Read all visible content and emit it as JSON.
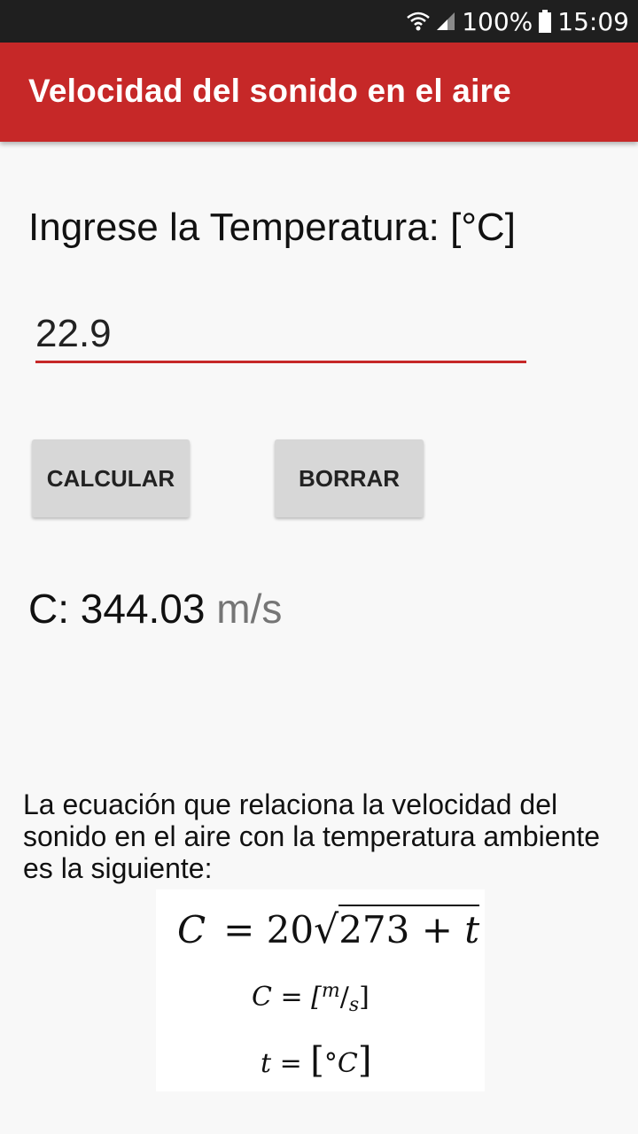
{
  "status_bar": {
    "battery": "100%",
    "time": "15:09",
    "icons": [
      "wifi-icon",
      "signal-icon",
      "battery-icon"
    ],
    "background": "#1f1f1f"
  },
  "app_bar": {
    "title": "Velocidad del sonido en el aire",
    "color": "#c62828"
  },
  "form": {
    "prompt": "Ingrese la Temperatura: [°C]",
    "temperature_value": "22.9",
    "calculate_label": "CALCULAR",
    "clear_label": "BORRAR"
  },
  "result": {
    "prefix": "C:",
    "value": "344.03",
    "unit": "m/s"
  },
  "explanation": "La ecuación que relaciona la velocidad del sonido en el aire con la temperatura ambiente es la siguiente:",
  "formula": {
    "lhs": "C",
    "equals_coef": "= 20",
    "sqrt": "√",
    "radicand_num": "273 + ",
    "radicand_var": "t",
    "unit1_lhs": "C = [",
    "unit1_num": "m",
    "unit1_slash": "/",
    "unit1_den": "s",
    "unit1_close": "]",
    "unit2_lhs": "t = ",
    "unit2_open": "[",
    "unit2_val": "°C",
    "unit2_close": "]"
  }
}
